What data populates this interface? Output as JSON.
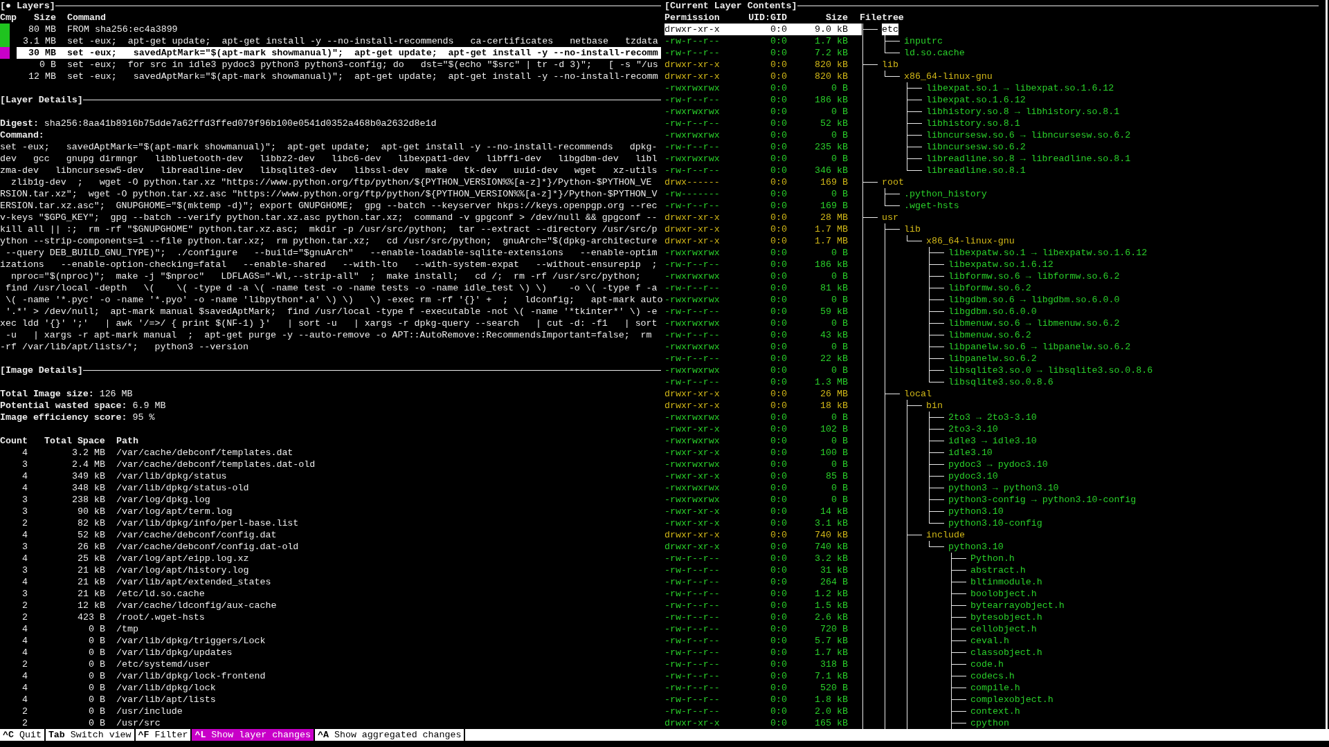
{
  "layers_pane": {
    "title": "[● Layers]",
    "columns": [
      "Cmp",
      "Size",
      "Command"
    ],
    "rows": [
      {
        "in_comparison": true,
        "size": "80 MB",
        "command": "FROM sha256:ec4a3899",
        "selected": false
      },
      {
        "in_comparison": true,
        "size": "3.1 MB",
        "command": "set -eux;  apt-get update;  apt-get install -y --no-install-recommends   ca-certificates   netbase   tzdata",
        "selected": false
      },
      {
        "in_comparison": true,
        "size": "30 MB",
        "command": "set -eux;   savedAptMark=\"$(apt-mark showmanual)\";  apt-get update;  apt-get install -y --no-install-recomm",
        "selected": true
      },
      {
        "in_comparison": false,
        "size": "0 B",
        "command": "set -eux;  for src in idle3 pydoc3 python3 python3-config; do   dst=\"$(echo \"$src\" | tr -d 3)\";   [ -s \"/us",
        "selected": false
      },
      {
        "in_comparison": false,
        "size": "12 MB",
        "command": "set -eux;   savedAptMark=\"$(apt-mark showmanual)\";  apt-get update;  apt-get install -y --no-install-recomm",
        "selected": false
      }
    ]
  },
  "layer_details": {
    "title": "[Layer Details]",
    "digest_label": "Digest:",
    "digest": "sha256:8aa41b8916b75dde7a62ffd3ffed079f96b100e0541d0352a468b0a2632d8e1d",
    "command_label": "Command:",
    "command_lines": [
      "set -eux;   savedAptMark=\"$(apt-mark showmanual)\";  apt-get update;  apt-get install -y --no-install-recommends   dpkg-",
      "dev   gcc   gnupg dirmngr   libbluetooth-dev   libbz2-dev   libc6-dev   libexpat1-dev   libffi-dev   libgdbm-dev   libl",
      "zma-dev   libncursesw5-dev   libreadline-dev   libsqlite3-dev   libssl-dev   make   tk-dev   uuid-dev   wget   xz-utils",
      "  zlib1g-dev  ;   wget -O python.tar.xz \"https://www.python.org/ftp/python/${PYTHON_VERSION%%[a-z]*}/Python-$PYTHON_VE",
      "RSION.tar.xz\";  wget -O python.tar.xz.asc \"https://www.python.org/ftp/python/${PYTHON_VERSION%%[a-z]*}/Python-$PYTHON_V",
      "ERSION.tar.xz.asc\";  GNUPGHOME=\"$(mktemp -d)\"; export GNUPGHOME;  gpg --batch --keyserver hkps://keys.openpgp.org --rec",
      "v-keys \"$GPG_KEY\";  gpg --batch --verify python.tar.xz.asc python.tar.xz;  command -v gpgconf > /dev/null && gpgconf --",
      "kill all || :;  rm -rf \"$GNUPGHOME\" python.tar.xz.asc;  mkdir -p /usr/src/python;  tar --extract --directory /usr/src/p",
      "ython --strip-components=1 --file python.tar.xz;  rm python.tar.xz;   cd /usr/src/python;  gnuArch=\"$(dpkg-architecture",
      " --query DEB_BUILD_GNU_TYPE)\";  ./configure   --build=\"$gnuArch\"   --enable-loadable-sqlite-extensions   --enable-optim",
      "izations   --enable-option-checking=fatal   --enable-shared   --with-lto   --with-system-expat   --without-ensurepip  ;",
      "  nproc=\"$(nproc)\";  make -j \"$nproc\"   LDFLAGS=\"-Wl,--strip-all\"  ;  make install;   cd /;  rm -rf /usr/src/python;",
      " find /usr/local -depth   \\(    \\( -type d -a \\( -name test -o -name tests -o -name idle_test \\) \\)    -o \\( -type f -a",
      " \\( -name '*.pyc' -o -name '*.pyo' -o -name 'libpython*.a' \\) \\)   \\) -exec rm -rf '{}' +  ;   ldconfig;   apt-mark auto",
      " '.*' > /dev/null;  apt-mark manual $savedAptMark;  find /usr/local -type f -executable -not \\( -name '*tkinter*' \\) -e",
      "xec ldd '{}' ';'   | awk '/=>/ { print $(NF-1) }'   | sort -u   | xargs -r dpkg-query --search   | cut -d: -f1   | sort",
      " -u   | xargs -r apt-mark manual  ;  apt-get purge -y --auto-remove -o APT::AutoRemove::RecommendsImportant=false;  rm",
      "-rf /var/lib/apt/lists/*;   python3 --version"
    ]
  },
  "image_details": {
    "title": "[Image Details]",
    "stats": [
      {
        "label": "Total Image size:",
        "value": "126 MB"
      },
      {
        "label": "Potential wasted space:",
        "value": "6.9 MB"
      },
      {
        "label": "Image efficiency score:",
        "value": "95 %"
      }
    ],
    "columns": [
      "Count",
      "Total Space",
      "Path"
    ],
    "rows": [
      {
        "count": "4",
        "space": "3.2 MB",
        "path": "/var/cache/debconf/templates.dat"
      },
      {
        "count": "3",
        "space": "2.4 MB",
        "path": "/var/cache/debconf/templates.dat-old"
      },
      {
        "count": "4",
        "space": "349 kB",
        "path": "/var/lib/dpkg/status"
      },
      {
        "count": "4",
        "space": "348 kB",
        "path": "/var/lib/dpkg/status-old"
      },
      {
        "count": "3",
        "space": "238 kB",
        "path": "/var/log/dpkg.log"
      },
      {
        "count": "3",
        "space": "90 kB",
        "path": "/var/log/apt/term.log"
      },
      {
        "count": "2",
        "space": "82 kB",
        "path": "/var/lib/dpkg/info/perl-base.list"
      },
      {
        "count": "4",
        "space": "52 kB",
        "path": "/var/cache/debconf/config.dat"
      },
      {
        "count": "3",
        "space": "26 kB",
        "path": "/var/cache/debconf/config.dat-old"
      },
      {
        "count": "4",
        "space": "25 kB",
        "path": "/var/log/apt/eipp.log.xz"
      },
      {
        "count": "3",
        "space": "21 kB",
        "path": "/var/log/apt/history.log"
      },
      {
        "count": "4",
        "space": "21 kB",
        "path": "/var/lib/apt/extended_states"
      },
      {
        "count": "3",
        "space": "21 kB",
        "path": "/etc/ld.so.cache"
      },
      {
        "count": "2",
        "space": "12 kB",
        "path": "/var/cache/ldconfig/aux-cache"
      },
      {
        "count": "2",
        "space": "423 B",
        "path": "/root/.wget-hsts"
      },
      {
        "count": "4",
        "space": "0 B",
        "path": "/tmp"
      },
      {
        "count": "4",
        "space": "0 B",
        "path": "/var/lib/dpkg/triggers/Lock"
      },
      {
        "count": "4",
        "space": "0 B",
        "path": "/var/lib/dpkg/updates"
      },
      {
        "count": "2",
        "space": "0 B",
        "path": "/etc/systemd/user"
      },
      {
        "count": "4",
        "space": "0 B",
        "path": "/var/lib/dpkg/lock-frontend"
      },
      {
        "count": "4",
        "space": "0 B",
        "path": "/var/lib/dpkg/lock"
      },
      {
        "count": "4",
        "space": "0 B",
        "path": "/var/lib/apt/lists"
      },
      {
        "count": "2",
        "space": "0 B",
        "path": "/usr/include"
      },
      {
        "count": "2",
        "space": "0 B",
        "path": "/usr/src"
      }
    ]
  },
  "contents_pane": {
    "title": "[Current Layer Contents]",
    "columns": [
      "Permission",
      "UID:GID",
      "Size",
      "Filetree"
    ]
  },
  "filetree": {
    "more_below": true,
    "nodes": [
      {
        "name": "etc",
        "permission": "drwxr-xr-x",
        "uid_gid": "0:0",
        "size": "9.0 kB",
        "added": false,
        "selected": true,
        "more_below": false,
        "children": [
          {
            "name": "inputrc",
            "permission": "-rw-r--r--",
            "uid_gid": "0:0",
            "size": "1.7 kB",
            "added": true,
            "selected": false
          },
          {
            "name": "ld.so.cache",
            "permission": "-rw-r--r--",
            "uid_gid": "0:0",
            "size": "7.2 kB",
            "added": true,
            "selected": false
          }
        ]
      },
      {
        "name": "lib",
        "permission": "drwxr-xr-x",
        "uid_gid": "0:0",
        "size": "820 kB",
        "added": false,
        "selected": false,
        "more_below": false,
        "children": [
          {
            "name": "x86_64-linux-gnu",
            "permission": "drwxr-xr-x",
            "uid_gid": "0:0",
            "size": "820 kB",
            "added": false,
            "selected": false,
            "more_below": false,
            "children": [
              {
                "name": "libexpat.so.1 → libexpat.so.1.6.12",
                "permission": "-rwxrwxrwx",
                "uid_gid": "0:0",
                "size": "0 B",
                "added": true,
                "selected": false
              },
              {
                "name": "libexpat.so.1.6.12",
                "permission": "-rw-r--r--",
                "uid_gid": "0:0",
                "size": "186 kB",
                "added": true,
                "selected": false
              },
              {
                "name": "libhistory.so.8 → libhistory.so.8.1",
                "permission": "-rwxrwxrwx",
                "uid_gid": "0:0",
                "size": "0 B",
                "added": true,
                "selected": false
              },
              {
                "name": "libhistory.so.8.1",
                "permission": "-rw-r--r--",
                "uid_gid": "0:0",
                "size": "52 kB",
                "added": true,
                "selected": false
              },
              {
                "name": "libncursesw.so.6 → libncursesw.so.6.2",
                "permission": "-rwxrwxrwx",
                "uid_gid": "0:0",
                "size": "0 B",
                "added": true,
                "selected": false
              },
              {
                "name": "libncursesw.so.6.2",
                "permission": "-rw-r--r--",
                "uid_gid": "0:0",
                "size": "235 kB",
                "added": true,
                "selected": false
              },
              {
                "name": "libreadline.so.8 → libreadline.so.8.1",
                "permission": "-rwxrwxrwx",
                "uid_gid": "0:0",
                "size": "0 B",
                "added": true,
                "selected": false
              },
              {
                "name": "libreadline.so.8.1",
                "permission": "-rw-r--r--",
                "uid_gid": "0:0",
                "size": "346 kB",
                "added": true,
                "selected": false
              }
            ]
          }
        ]
      },
      {
        "name": "root",
        "permission": "drwx------",
        "uid_gid": "0:0",
        "size": "169 B",
        "added": false,
        "selected": false,
        "more_below": false,
        "children": [
          {
            "name": ".python_history",
            "permission": "-rw-------",
            "uid_gid": "0:0",
            "size": "0 B",
            "added": true,
            "selected": false
          },
          {
            "name": ".wget-hsts",
            "permission": "-rw-r--r--",
            "uid_gid": "0:0",
            "size": "169 B",
            "added": true,
            "selected": false
          }
        ]
      },
      {
        "name": "usr",
        "permission": "drwxr-xr-x",
        "uid_gid": "0:0",
        "size": "28 MB",
        "added": false,
        "selected": false,
        "more_below": true,
        "children": [
          {
            "name": "lib",
            "permission": "drwxr-xr-x",
            "uid_gid": "0:0",
            "size": "1.7 MB",
            "added": false,
            "selected": false,
            "more_below": false,
            "children": [
              {
                "name": "x86_64-linux-gnu",
                "permission": "drwxr-xr-x",
                "uid_gid": "0:0",
                "size": "1.7 MB",
                "added": false,
                "selected": false,
                "more_below": false,
                "children": [
                  {
                    "name": "libexpatw.so.1 → libexpatw.so.1.6.12",
                    "permission": "-rwxrwxrwx",
                    "uid_gid": "0:0",
                    "size": "0 B",
                    "added": true,
                    "selected": false
                  },
                  {
                    "name": "libexpatw.so.1.6.12",
                    "permission": "-rw-r--r--",
                    "uid_gid": "0:0",
                    "size": "186 kB",
                    "added": true,
                    "selected": false
                  },
                  {
                    "name": "libformw.so.6 → libformw.so.6.2",
                    "permission": "-rwxrwxrwx",
                    "uid_gid": "0:0",
                    "size": "0 B",
                    "added": true,
                    "selected": false
                  },
                  {
                    "name": "libformw.so.6.2",
                    "permission": "-rw-r--r--",
                    "uid_gid": "0:0",
                    "size": "81 kB",
                    "added": true,
                    "selected": false
                  },
                  {
                    "name": "libgdbm.so.6 → libgdbm.so.6.0.0",
                    "permission": "-rwxrwxrwx",
                    "uid_gid": "0:0",
                    "size": "0 B",
                    "added": true,
                    "selected": false
                  },
                  {
                    "name": "libgdbm.so.6.0.0",
                    "permission": "-rw-r--r--",
                    "uid_gid": "0:0",
                    "size": "59 kB",
                    "added": true,
                    "selected": false
                  },
                  {
                    "name": "libmenuw.so.6 → libmenuw.so.6.2",
                    "permission": "-rwxrwxrwx",
                    "uid_gid": "0:0",
                    "size": "0 B",
                    "added": true,
                    "selected": false
                  },
                  {
                    "name": "libmenuw.so.6.2",
                    "permission": "-rw-r--r--",
                    "uid_gid": "0:0",
                    "size": "43 kB",
                    "added": true,
                    "selected": false
                  },
                  {
                    "name": "libpanelw.so.6 → libpanelw.so.6.2",
                    "permission": "-rwxrwxrwx",
                    "uid_gid": "0:0",
                    "size": "0 B",
                    "added": true,
                    "selected": false
                  },
                  {
                    "name": "libpanelw.so.6.2",
                    "permission": "-rw-r--r--",
                    "uid_gid": "0:0",
                    "size": "22 kB",
                    "added": true,
                    "selected": false
                  },
                  {
                    "name": "libsqlite3.so.0 → libsqlite3.so.0.8.6",
                    "permission": "-rwxrwxrwx",
                    "uid_gid": "0:0",
                    "size": "0 B",
                    "added": true,
                    "selected": false
                  },
                  {
                    "name": "libsqlite3.so.0.8.6",
                    "permission": "-rw-r--r--",
                    "uid_gid": "0:0",
                    "size": "1.3 MB",
                    "added": true,
                    "selected": false
                  }
                ]
              }
            ]
          },
          {
            "name": "local",
            "permission": "drwxr-xr-x",
            "uid_gid": "0:0",
            "size": "26 MB",
            "added": false,
            "selected": false,
            "more_below": true,
            "children": [
              {
                "name": "bin",
                "permission": "drwxr-xr-x",
                "uid_gid": "0:0",
                "size": "18 kB",
                "added": false,
                "selected": false,
                "more_below": false,
                "children": [
                  {
                    "name": "2to3 → 2to3-3.10",
                    "permission": "-rwxrwxrwx",
                    "uid_gid": "0:0",
                    "size": "0 B",
                    "added": true,
                    "selected": false
                  },
                  {
                    "name": "2to3-3.10",
                    "permission": "-rwxr-xr-x",
                    "uid_gid": "0:0",
                    "size": "102 B",
                    "added": true,
                    "selected": false
                  },
                  {
                    "name": "idle3 → idle3.10",
                    "permission": "-rwxrwxrwx",
                    "uid_gid": "0:0",
                    "size": "0 B",
                    "added": true,
                    "selected": false
                  },
                  {
                    "name": "idle3.10",
                    "permission": "-rwxr-xr-x",
                    "uid_gid": "0:0",
                    "size": "100 B",
                    "added": true,
                    "selected": false
                  },
                  {
                    "name": "pydoc3 → pydoc3.10",
                    "permission": "-rwxrwxrwx",
                    "uid_gid": "0:0",
                    "size": "0 B",
                    "added": true,
                    "selected": false
                  },
                  {
                    "name": "pydoc3.10",
                    "permission": "-rwxr-xr-x",
                    "uid_gid": "0:0",
                    "size": "85 B",
                    "added": true,
                    "selected": false
                  },
                  {
                    "name": "python3 → python3.10",
                    "permission": "-rwxrwxrwx",
                    "uid_gid": "0:0",
                    "size": "0 B",
                    "added": true,
                    "selected": false
                  },
                  {
                    "name": "python3-config → python3.10-config",
                    "permission": "-rwxrwxrwx",
                    "uid_gid": "0:0",
                    "size": "0 B",
                    "added": true,
                    "selected": false
                  },
                  {
                    "name": "python3.10",
                    "permission": "-rwxr-xr-x",
                    "uid_gid": "0:0",
                    "size": "14 kB",
                    "added": true,
                    "selected": false
                  },
                  {
                    "name": "python3.10-config",
                    "permission": "-rwxr-xr-x",
                    "uid_gid": "0:0",
                    "size": "3.1 kB",
                    "added": true,
                    "selected": false
                  }
                ]
              },
              {
                "name": "include",
                "permission": "drwxr-xr-x",
                "uid_gid": "0:0",
                "size": "740 kB",
                "added": false,
                "selected": false,
                "more_below": false,
                "children": [
                  {
                    "name": "python3.10",
                    "permission": "drwxr-xr-x",
                    "uid_gid": "0:0",
                    "size": "740 kB",
                    "added": true,
                    "selected": false,
                    "more_below": true,
                    "children": [
                      {
                        "name": "Python.h",
                        "permission": "-rw-r--r--",
                        "uid_gid": "0:0",
                        "size": "3.2 kB",
                        "added": true,
                        "selected": false
                      },
                      {
                        "name": "abstract.h",
                        "permission": "-rw-r--r--",
                        "uid_gid": "0:0",
                        "size": "31 kB",
                        "added": true,
                        "selected": false
                      },
                      {
                        "name": "bltinmodule.h",
                        "permission": "-rw-r--r--",
                        "uid_gid": "0:0",
                        "size": "264 B",
                        "added": true,
                        "selected": false
                      },
                      {
                        "name": "boolobject.h",
                        "permission": "-rw-r--r--",
                        "uid_gid": "0:0",
                        "size": "1.2 kB",
                        "added": true,
                        "selected": false
                      },
                      {
                        "name": "bytearrayobject.h",
                        "permission": "-rw-r--r--",
                        "uid_gid": "0:0",
                        "size": "1.5 kB",
                        "added": true,
                        "selected": false
                      },
                      {
                        "name": "bytesobject.h",
                        "permission": "-rw-r--r--",
                        "uid_gid": "0:0",
                        "size": "2.6 kB",
                        "added": true,
                        "selected": false
                      },
                      {
                        "name": "cellobject.h",
                        "permission": "-rw-r--r--",
                        "uid_gid": "0:0",
                        "size": "720 B",
                        "added": true,
                        "selected": false
                      },
                      {
                        "name": "ceval.h",
                        "permission": "-rw-r--r--",
                        "uid_gid": "0:0",
                        "size": "5.7 kB",
                        "added": true,
                        "selected": false
                      },
                      {
                        "name": "classobject.h",
                        "permission": "-rw-r--r--",
                        "uid_gid": "0:0",
                        "size": "1.7 kB",
                        "added": true,
                        "selected": false
                      },
                      {
                        "name": "code.h",
                        "permission": "-rw-r--r--",
                        "uid_gid": "0:0",
                        "size": "318 B",
                        "added": true,
                        "selected": false
                      },
                      {
                        "name": "codecs.h",
                        "permission": "-rw-r--r--",
                        "uid_gid": "0:0",
                        "size": "7.1 kB",
                        "added": true,
                        "selected": false
                      },
                      {
                        "name": "compile.h",
                        "permission": "-rw-r--r--",
                        "uid_gid": "0:0",
                        "size": "520 B",
                        "added": true,
                        "selected": false
                      },
                      {
                        "name": "complexobject.h",
                        "permission": "-rw-r--r--",
                        "uid_gid": "0:0",
                        "size": "1.8 kB",
                        "added": true,
                        "selected": false
                      },
                      {
                        "name": "context.h",
                        "permission": "-rw-r--r--",
                        "uid_gid": "0:0",
                        "size": "2.0 kB",
                        "added": true,
                        "selected": false
                      },
                      {
                        "name": "cpython",
                        "permission": "drwxr-xr-x",
                        "uid_gid": "0:0",
                        "size": "165 kB",
                        "added": true,
                        "selected": false
                      }
                    ]
                  }
                ]
              }
            ]
          }
        ]
      }
    ]
  },
  "keybar": [
    {
      "key": "^C",
      "label": "Quit",
      "selected": false
    },
    {
      "key": "Tab",
      "label": "Switch view",
      "selected": false
    },
    {
      "key": "^F",
      "label": "Filter",
      "selected": false
    },
    {
      "key": "^L",
      "label": "Show layer changes",
      "selected": true
    },
    {
      "key": "^A",
      "label": "Show aggregated changes",
      "selected": false
    }
  ]
}
